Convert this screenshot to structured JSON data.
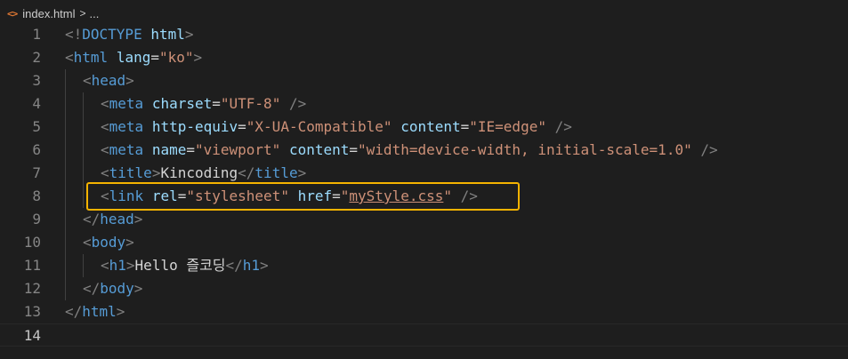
{
  "breadcrumb": {
    "icon": "html-file-icon",
    "file": "index.html",
    "separator": ">",
    "rest": "..."
  },
  "lines": [
    {
      "n": "1",
      "indent": 0,
      "tokens": [
        {
          "c": "br",
          "t": "<!"
        },
        {
          "c": "tag",
          "t": "DOCTYPE"
        },
        {
          "c": "text",
          "t": " "
        },
        {
          "c": "attr",
          "t": "html"
        },
        {
          "c": "br",
          "t": ">"
        }
      ]
    },
    {
      "n": "2",
      "indent": 0,
      "tokens": [
        {
          "c": "br",
          "t": "<"
        },
        {
          "c": "tag",
          "t": "html"
        },
        {
          "c": "text",
          "t": " "
        },
        {
          "c": "attr",
          "t": "lang"
        },
        {
          "c": "eq",
          "t": "="
        },
        {
          "c": "str",
          "t": "\"ko\""
        },
        {
          "c": "br",
          "t": ">"
        }
      ]
    },
    {
      "n": "3",
      "indent": 1,
      "tokens": [
        {
          "c": "br",
          "t": "<"
        },
        {
          "c": "tag",
          "t": "head"
        },
        {
          "c": "br",
          "t": ">"
        }
      ]
    },
    {
      "n": "4",
      "indent": 2,
      "tokens": [
        {
          "c": "br",
          "t": "<"
        },
        {
          "c": "tag",
          "t": "meta"
        },
        {
          "c": "text",
          "t": " "
        },
        {
          "c": "attr",
          "t": "charset"
        },
        {
          "c": "eq",
          "t": "="
        },
        {
          "c": "str",
          "t": "\"UTF-8\""
        },
        {
          "c": "text",
          "t": " "
        },
        {
          "c": "br",
          "t": "/>"
        }
      ]
    },
    {
      "n": "5",
      "indent": 2,
      "tokens": [
        {
          "c": "br",
          "t": "<"
        },
        {
          "c": "tag",
          "t": "meta"
        },
        {
          "c": "text",
          "t": " "
        },
        {
          "c": "attr",
          "t": "http-equiv"
        },
        {
          "c": "eq",
          "t": "="
        },
        {
          "c": "str",
          "t": "\"X-UA-Compatible\""
        },
        {
          "c": "text",
          "t": " "
        },
        {
          "c": "attr",
          "t": "content"
        },
        {
          "c": "eq",
          "t": "="
        },
        {
          "c": "str",
          "t": "\"IE=edge\""
        },
        {
          "c": "text",
          "t": " "
        },
        {
          "c": "br",
          "t": "/>"
        }
      ]
    },
    {
      "n": "6",
      "indent": 2,
      "tokens": [
        {
          "c": "br",
          "t": "<"
        },
        {
          "c": "tag",
          "t": "meta"
        },
        {
          "c": "text",
          "t": " "
        },
        {
          "c": "attr",
          "t": "name"
        },
        {
          "c": "eq",
          "t": "="
        },
        {
          "c": "str",
          "t": "\"viewport\""
        },
        {
          "c": "text",
          "t": " "
        },
        {
          "c": "attr",
          "t": "content"
        },
        {
          "c": "eq",
          "t": "="
        },
        {
          "c": "str",
          "t": "\"width=device-width, initial-scale=1.0\""
        },
        {
          "c": "text",
          "t": " "
        },
        {
          "c": "br",
          "t": "/>"
        }
      ]
    },
    {
      "n": "7",
      "indent": 2,
      "tokens": [
        {
          "c": "br",
          "t": "<"
        },
        {
          "c": "tag",
          "t": "title"
        },
        {
          "c": "br",
          "t": ">"
        },
        {
          "c": "text",
          "t": "Kincoding"
        },
        {
          "c": "br",
          "t": "</"
        },
        {
          "c": "tag",
          "t": "title"
        },
        {
          "c": "br",
          "t": ">"
        }
      ]
    },
    {
      "n": "8",
      "indent": 2,
      "tokens": [
        {
          "c": "br",
          "t": "<"
        },
        {
          "c": "tag",
          "t": "link"
        },
        {
          "c": "text",
          "t": " "
        },
        {
          "c": "attr",
          "t": "rel"
        },
        {
          "c": "eq",
          "t": "="
        },
        {
          "c": "str",
          "t": "\"stylesheet\""
        },
        {
          "c": "text",
          "t": " "
        },
        {
          "c": "attr",
          "t": "href"
        },
        {
          "c": "eq",
          "t": "="
        },
        {
          "c": "str",
          "t": "\""
        },
        {
          "c": "link",
          "t": "myStyle.css"
        },
        {
          "c": "str",
          "t": "\""
        },
        {
          "c": "text",
          "t": " "
        },
        {
          "c": "br",
          "t": "/>"
        }
      ]
    },
    {
      "n": "9",
      "indent": 1,
      "tokens": [
        {
          "c": "br",
          "t": "</"
        },
        {
          "c": "tag",
          "t": "head"
        },
        {
          "c": "br",
          "t": ">"
        }
      ]
    },
    {
      "n": "10",
      "indent": 1,
      "tokens": [
        {
          "c": "br",
          "t": "<"
        },
        {
          "c": "tag",
          "t": "body"
        },
        {
          "c": "br",
          "t": ">"
        }
      ]
    },
    {
      "n": "11",
      "indent": 2,
      "tokens": [
        {
          "c": "br",
          "t": "<"
        },
        {
          "c": "tag",
          "t": "h1"
        },
        {
          "c": "br",
          "t": ">"
        },
        {
          "c": "text",
          "t": "Hello 즐코딩"
        },
        {
          "c": "br",
          "t": "</"
        },
        {
          "c": "tag",
          "t": "h1"
        },
        {
          "c": "br",
          "t": ">"
        }
      ]
    },
    {
      "n": "12",
      "indent": 1,
      "tokens": [
        {
          "c": "br",
          "t": "</"
        },
        {
          "c": "tag",
          "t": "body"
        },
        {
          "c": "br",
          "t": ">"
        }
      ]
    },
    {
      "n": "13",
      "indent": 0,
      "tokens": [
        {
          "c": "br",
          "t": "</"
        },
        {
          "c": "tag",
          "t": "html"
        },
        {
          "c": "br",
          "t": ">"
        }
      ]
    },
    {
      "n": "14",
      "indent": 0,
      "active": true,
      "tokens": []
    }
  ],
  "highlight": {
    "line": "8",
    "color": "#f5b300"
  },
  "colors": {
    "background": "#1e1e1e",
    "tag": "#569cd6",
    "attribute": "#9cdcfe",
    "string": "#ce9178",
    "punctuation": "#808080",
    "text": "#d4d4d4",
    "line_number": "#858585"
  }
}
